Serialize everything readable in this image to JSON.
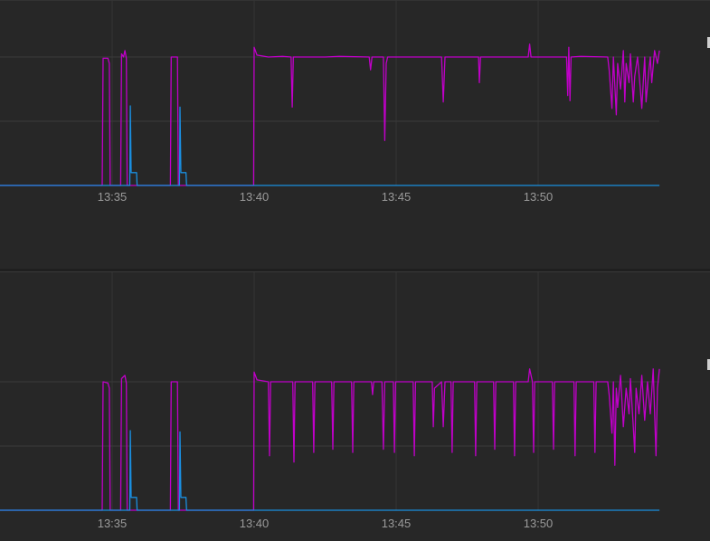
{
  "chart_data": [
    {
      "type": "line",
      "title": "",
      "xlabel": "",
      "ylabel": "",
      "x_unit": "minutes after 13:30",
      "xlim": [
        0,
        24.27
      ],
      "ylim": [
        0,
        2.9
      ],
      "x_ticks": [
        {
          "t": 5,
          "label": "13:35"
        },
        {
          "t": 10,
          "label": "13:40"
        },
        {
          "t": 15,
          "label": "13:45"
        },
        {
          "t": 20,
          "label": "13:50"
        }
      ],
      "y_grid": [
        1,
        2
      ],
      "grid": true,
      "legend": "right",
      "series": [
        {
          "name": "magenta",
          "color": "#c000c8",
          "points": [
            [
              0,
              0
            ],
            [
              4.65,
              0
            ],
            [
              4.68,
              1.98
            ],
            [
              4.85,
              1.98
            ],
            [
              4.9,
              1.9
            ],
            [
              4.93,
              0
            ],
            [
              5.3,
              0
            ],
            [
              5.33,
              2.05
            ],
            [
              5.4,
              2.0
            ],
            [
              5.45,
              2.1
            ],
            [
              5.5,
              1.98
            ],
            [
              5.53,
              0
            ],
            [
              7.05,
              0
            ],
            [
              7.08,
              2.0
            ],
            [
              7.3,
              2.0
            ],
            [
              7.33,
              0
            ],
            [
              9.98,
              0
            ],
            [
              10.0,
              2.15
            ],
            [
              10.1,
              2.03
            ],
            [
              10.5,
              2.0
            ],
            [
              11.0,
              2.01
            ],
            [
              11.3,
              2.0
            ],
            [
              11.34,
              1.22
            ],
            [
              11.38,
              2.0
            ],
            [
              12.5,
              2.0
            ],
            [
              13.0,
              2.01
            ],
            [
              14.05,
              2.0
            ],
            [
              14.1,
              1.8
            ],
            [
              14.15,
              2.0
            ],
            [
              14.55,
              2.0
            ],
            [
              14.6,
              0.7
            ],
            [
              14.65,
              1.9
            ],
            [
              14.7,
              2.0
            ],
            [
              16.6,
              2.0
            ],
            [
              16.66,
              1.3
            ],
            [
              16.72,
              2.0
            ],
            [
              17.9,
              2.0
            ],
            [
              17.93,
              1.6
            ],
            [
              17.97,
              2.0
            ],
            [
              19.65,
              2.0
            ],
            [
              19.7,
              2.2
            ],
            [
              19.75,
              2.0
            ],
            [
              21.0,
              2.0
            ],
            [
              21.04,
              1.4
            ],
            [
              21.08,
              2.15
            ],
            [
              21.12,
              1.32
            ],
            [
              21.16,
              2.0
            ],
            [
              21.5,
              2.01
            ],
            [
              22.45,
              2.0
            ],
            [
              22.5,
              1.8
            ],
            [
              22.6,
              1.2
            ],
            [
              22.65,
              2.0
            ],
            [
              22.75,
              1.1
            ],
            [
              22.8,
              1.9
            ],
            [
              22.9,
              1.5
            ],
            [
              23.0,
              2.1
            ],
            [
              23.05,
              1.3
            ],
            [
              23.1,
              1.9
            ],
            [
              23.2,
              1.6
            ],
            [
              23.25,
              2.05
            ],
            [
              23.35,
              1.3
            ],
            [
              23.4,
              1.7
            ],
            [
              23.5,
              2.0
            ],
            [
              23.6,
              1.5
            ],
            [
              23.65,
              1.2
            ],
            [
              23.75,
              2.0
            ],
            [
              23.8,
              1.3
            ],
            [
              23.9,
              1.8
            ],
            [
              23.95,
              2.0
            ],
            [
              24.0,
              1.6
            ],
            [
              24.1,
              2.1
            ],
            [
              24.2,
              1.9
            ],
            [
              24.27,
              2.1
            ]
          ]
        },
        {
          "name": "blue",
          "color": "#1a8fe0",
          "points": [
            [
              0,
              0
            ],
            [
              5.62,
              0
            ],
            [
              5.64,
              1.24
            ],
            [
              5.67,
              0.2
            ],
            [
              5.86,
              0.2
            ],
            [
              5.88,
              0
            ],
            [
              7.37,
              0
            ],
            [
              7.39,
              1.22
            ],
            [
              7.42,
              0.2
            ],
            [
              7.6,
              0.2
            ],
            [
              7.62,
              0
            ],
            [
              24.27,
              0
            ]
          ]
        }
      ]
    },
    {
      "type": "line",
      "title": "",
      "xlabel": "",
      "ylabel": "",
      "x_unit": "minutes after 13:30",
      "xlim": [
        0,
        24.27
      ],
      "ylim": [
        0,
        2.9
      ],
      "x_ticks": [
        {
          "t": 5,
          "label": "13:35"
        },
        {
          "t": 10,
          "label": "13:40"
        },
        {
          "t": 15,
          "label": "13:45"
        },
        {
          "t": 20,
          "label": "13:50"
        }
      ],
      "y_grid": [
        1,
        2
      ],
      "grid": true,
      "legend": "right",
      "series": [
        {
          "name": "magenta",
          "color": "#c000c8",
          "points": [
            [
              0,
              0
            ],
            [
              4.65,
              0
            ],
            [
              4.68,
              2.0
            ],
            [
              4.85,
              1.98
            ],
            [
              4.9,
              1.9
            ],
            [
              4.93,
              0
            ],
            [
              5.3,
              0
            ],
            [
              5.33,
              2.05
            ],
            [
              5.45,
              2.1
            ],
            [
              5.5,
              1.98
            ],
            [
              5.53,
              0
            ],
            [
              7.05,
              0
            ],
            [
              7.08,
              2.0
            ],
            [
              7.3,
              2.0
            ],
            [
              7.33,
              0
            ],
            [
              9.98,
              0
            ],
            [
              10.0,
              2.15
            ],
            [
              10.1,
              2.03
            ],
            [
              10.5,
              2.0
            ],
            [
              10.54,
              0.85
            ],
            [
              10.58,
              2.0
            ],
            [
              11.36,
              2.0
            ],
            [
              11.4,
              0.75
            ],
            [
              11.44,
              2.0
            ],
            [
              12.06,
              2.0
            ],
            [
              12.1,
              0.9
            ],
            [
              12.14,
              2.0
            ],
            [
              12.73,
              2.0
            ],
            [
              12.77,
              0.95
            ],
            [
              12.81,
              2.0
            ],
            [
              13.43,
              2.0
            ],
            [
              13.47,
              0.9
            ],
            [
              13.51,
              2.0
            ],
            [
              14.13,
              2.0
            ],
            [
              14.17,
              1.8
            ],
            [
              14.21,
              2.0
            ],
            [
              14.5,
              2.0
            ],
            [
              14.55,
              0.95
            ],
            [
              14.6,
              2.0
            ],
            [
              14.9,
              2.0
            ],
            [
              14.94,
              0.9
            ],
            [
              14.98,
              2.0
            ],
            [
              15.6,
              2.0
            ],
            [
              15.64,
              0.85
            ],
            [
              15.68,
              2.0
            ],
            [
              16.27,
              2.0
            ],
            [
              16.31,
              1.3
            ],
            [
              16.35,
              1.9
            ],
            [
              16.6,
              2.0
            ],
            [
              16.66,
              1.3
            ],
            [
              16.72,
              2.0
            ],
            [
              16.93,
              2.0
            ],
            [
              16.97,
              0.9
            ],
            [
              17.01,
              2.0
            ],
            [
              17.76,
              2.0
            ],
            [
              17.8,
              0.85
            ],
            [
              17.84,
              2.0
            ],
            [
              18.43,
              2.0
            ],
            [
              18.47,
              0.95
            ],
            [
              18.51,
              2.0
            ],
            [
              19.13,
              2.0
            ],
            [
              19.17,
              0.85
            ],
            [
              19.21,
              2.0
            ],
            [
              19.65,
              2.0
            ],
            [
              19.7,
              2.2
            ],
            [
              19.8,
              2.0
            ],
            [
              19.84,
              0.9
            ],
            [
              19.88,
              2.0
            ],
            [
              20.5,
              2.0
            ],
            [
              20.54,
              0.95
            ],
            [
              20.58,
              2.0
            ],
            [
              21.26,
              2.0
            ],
            [
              21.3,
              0.85
            ],
            [
              21.34,
              2.0
            ],
            [
              21.96,
              2.0
            ],
            [
              22.0,
              0.9
            ],
            [
              22.04,
              2.0
            ],
            [
              22.45,
              2.0
            ],
            [
              22.5,
              1.8
            ],
            [
              22.6,
              1.2
            ],
            [
              22.65,
              2.0
            ],
            [
              22.7,
              0.7
            ],
            [
              22.75,
              1.9
            ],
            [
              22.8,
              1.6
            ],
            [
              22.9,
              2.1
            ],
            [
              23.0,
              1.3
            ],
            [
              23.1,
              1.9
            ],
            [
              23.2,
              1.5
            ],
            [
              23.25,
              2.05
            ],
            [
              23.35,
              1.3
            ],
            [
              23.4,
              0.9
            ],
            [
              23.45,
              1.9
            ],
            [
              23.55,
              1.5
            ],
            [
              23.65,
              2.1
            ],
            [
              23.75,
              1.4
            ],
            [
              23.85,
              2.0
            ],
            [
              23.95,
              1.5
            ],
            [
              24.05,
              2.2
            ],
            [
              24.15,
              0.85
            ],
            [
              24.2,
              1.9
            ],
            [
              24.27,
              2.2
            ]
          ]
        },
        {
          "name": "blue",
          "color": "#1a8fe0",
          "points": [
            [
              0,
              0
            ],
            [
              5.62,
              0
            ],
            [
              5.64,
              1.24
            ],
            [
              5.67,
              0.2
            ],
            [
              5.86,
              0.2
            ],
            [
              5.88,
              0
            ],
            [
              7.37,
              0
            ],
            [
              7.39,
              1.22
            ],
            [
              7.42,
              0.2
            ],
            [
              7.6,
              0.2
            ],
            [
              7.62,
              0
            ],
            [
              24.27,
              0
            ]
          ]
        }
      ]
    }
  ]
}
